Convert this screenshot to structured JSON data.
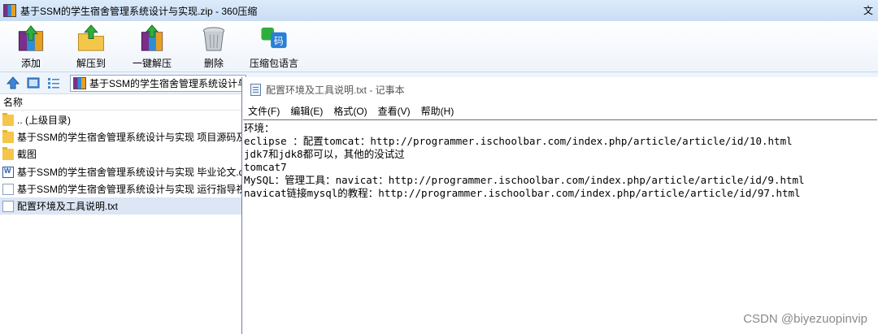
{
  "archive_window": {
    "title": "基于SSM的学生宿舍管理系统设计与实现.zip - 360压缩",
    "title_right": "文",
    "toolbar": {
      "add": "添加",
      "extract_to": "解压到",
      "one_click_extract": "一键解压",
      "delete": "删除",
      "archive_language": "压缩包语言",
      "archive_language_icon_text": "码"
    },
    "path": "基于SSM的学生宿舍管理系统设计与实现.zip",
    "column_name": "名称",
    "files": [
      {
        "name": ".. (上级目录)",
        "icon": "folder-icon"
      },
      {
        "name": "基于SSM的学生宿舍管理系统设计与实现 项目源码及",
        "icon": "folder-icon"
      },
      {
        "name": "截图",
        "icon": "folder-icon"
      },
      {
        "name": "基于SSM的学生宿舍管理系统设计与实现 毕业论文.doc",
        "icon": "word-icon"
      },
      {
        "name": "基于SSM的学生宿舍管理系统设计与实现 运行指导视",
        "icon": "document-icon"
      },
      {
        "name": "配置环境及工具说明.txt",
        "icon": "text-file-icon"
      }
    ]
  },
  "notepad": {
    "title": "配置环境及工具说明.txt - 记事本",
    "menu": [
      "文件(F)",
      "编辑(E)",
      "格式(O)",
      "查看(V)",
      "帮助(H)"
    ],
    "lines": [
      "环境：",
      "eclipse ：配置tomcat：http://programmer.ischoolbar.com/index.php/article/article/id/10.html",
      "jdk7和jdk8都可以，其他的没试过",
      "tomcat7",
      "MySQL：管理工具：navicat：http://programmer.ischoolbar.com/index.php/article/article/id/9.html",
      "navicat链接mysql的教程：http://programmer.ischoolbar.com/index.php/article/article/id/97.html"
    ]
  },
  "watermark": "CSDN @biyezuopinvip"
}
